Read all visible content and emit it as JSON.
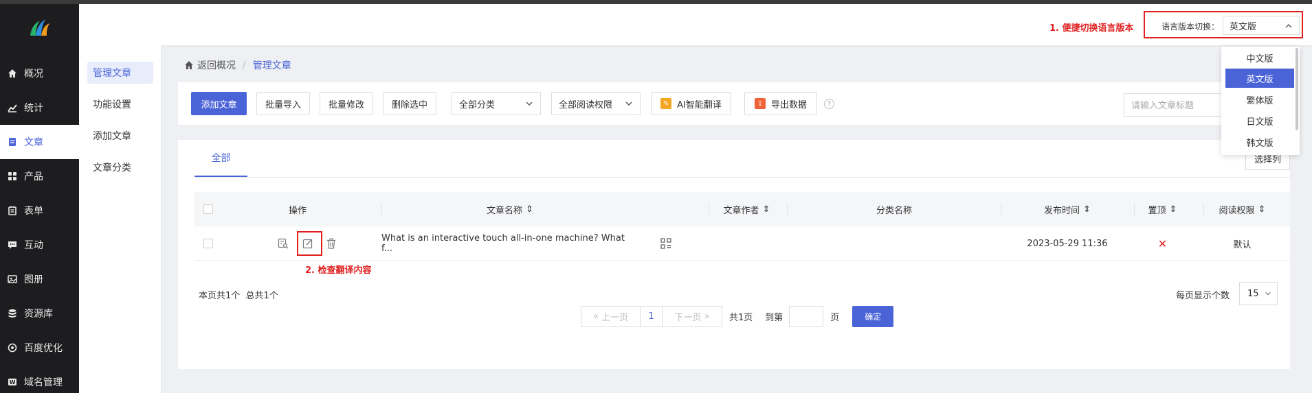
{
  "nav": [
    {
      "label": "概况",
      "icon": "home-icon"
    },
    {
      "label": "统计",
      "icon": "chart-icon"
    },
    {
      "label": "文章",
      "icon": "article-icon"
    },
    {
      "label": "产品",
      "icon": "grid-icon"
    },
    {
      "label": "表单",
      "icon": "form-icon"
    },
    {
      "label": "互动",
      "icon": "chat-icon"
    },
    {
      "label": "图册",
      "icon": "album-icon"
    },
    {
      "label": "资源库",
      "icon": "database-icon"
    },
    {
      "label": "百度优化",
      "icon": "seo-icon"
    },
    {
      "label": "域名管理",
      "icon": "domain-icon"
    }
  ],
  "subnav": [
    "管理文章",
    "功能设置",
    "添加文章",
    "文章分类"
  ],
  "breadcrumb": {
    "back": "返回概况",
    "current": "管理文章"
  },
  "toolbar": {
    "add": "添加文章",
    "import": "批量导入",
    "batch_edit": "批量修改",
    "delete": "删除选中",
    "category": "全部分类",
    "permission": "全部阅读权限",
    "ai_translate": "AI智能翻译",
    "export": "导出数据",
    "search_placeholder": "请输入文章标题"
  },
  "tabs": [
    "全部"
  ],
  "choose_columns": "选择列",
  "columns": [
    "操作",
    "文章名称",
    "文章作者",
    "分类名称",
    "发布时间",
    "置顶",
    "阅读权限"
  ],
  "rows": [
    {
      "title": "What is an interactive touch all-in-one machine? What f...",
      "author": "",
      "category": "",
      "date": "2023-05-29 11:36",
      "pinned": "✕",
      "permission": "默认"
    }
  ],
  "pager": {
    "page_count": "本页共1个",
    "total": "总共1个",
    "prev": "上一页",
    "current": "1",
    "next": "下一页",
    "total_pages": "共1页",
    "goto": "到第",
    "page_unit": "页",
    "confirm": "确定",
    "per_page_label": "每页显示个数",
    "per_page": "15"
  },
  "lang_switch": {
    "label": "语言版本切换：",
    "value": "英文版",
    "options": [
      "中文版",
      "英文版",
      "繁体版",
      "日文版",
      "韩文版"
    ]
  },
  "annotations": {
    "a1": "1. 便捷切换语言版本",
    "a2": "2. 检查翻译内容"
  },
  "colors": {
    "accent": "#4a63d7",
    "annotation": "#e02020",
    "sidebar": "#1d1d1f"
  }
}
